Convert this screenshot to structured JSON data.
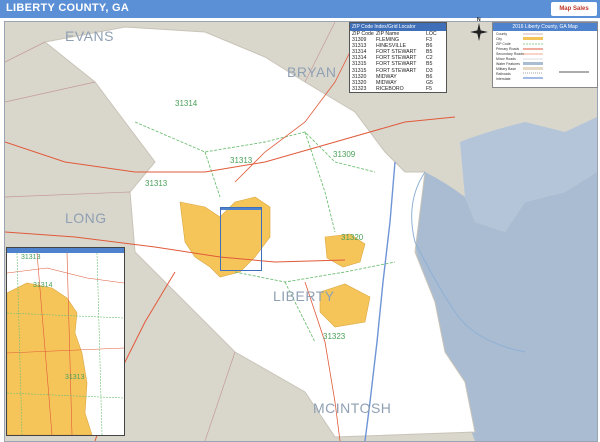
{
  "title": "LIBERTY COUNTY, GA",
  "logo_text": "Map Sales",
  "counties": {
    "evans": "EVANS",
    "bryan": "BRYAN",
    "long": "LONG",
    "liberty": "LIBERTY",
    "mcintosh": "MCINTOSH"
  },
  "zip_labels": {
    "z31314": "31314",
    "z31313": "31313",
    "z31313_b": "31313",
    "z31309": "31309",
    "z31320": "31320",
    "z31323": "31323"
  },
  "zip_table": {
    "header": "ZIP Code Index/Grid Locator",
    "columns": [
      "ZIP Code",
      "ZIP Name",
      "LOC"
    ],
    "rows": [
      [
        "31309",
        "FLEMING",
        "F3"
      ],
      [
        "31313",
        "HINESVILLE",
        "B6"
      ],
      [
        "31314",
        "FORT STEWART",
        "B5"
      ],
      [
        "31314",
        "FORT STEWART",
        "C2"
      ],
      [
        "31315",
        "FORT STEWART",
        "B5"
      ],
      [
        "31315",
        "FORT STEWART",
        "D3"
      ],
      [
        "31320",
        "MIDWAY",
        "B6"
      ],
      [
        "31320",
        "MIDWAY",
        "G5"
      ],
      [
        "31323",
        "RICEBORO",
        "F5"
      ]
    ]
  },
  "legend": {
    "title": "2016 Liberty County, GA Map",
    "items": [
      "County",
      "City",
      "ZIP Code",
      "Primary Roads",
      "Secondary Roads",
      "Minor Roads",
      "Water Features",
      "Military Base",
      "Railroads",
      "Interstate"
    ]
  },
  "compass_label": "N",
  "inset": {
    "zips": [
      "31313",
      "31314",
      "31313"
    ]
  },
  "colors": {
    "header": "#5b8fd6",
    "land_outside": "#d9d6cc",
    "county": "#ffffff",
    "water": "#a9bcd2",
    "city": "#f6c55a",
    "zip_line": "#6fbf73",
    "road_red": "#e05a3a",
    "road_blue": "#6f94d6"
  }
}
